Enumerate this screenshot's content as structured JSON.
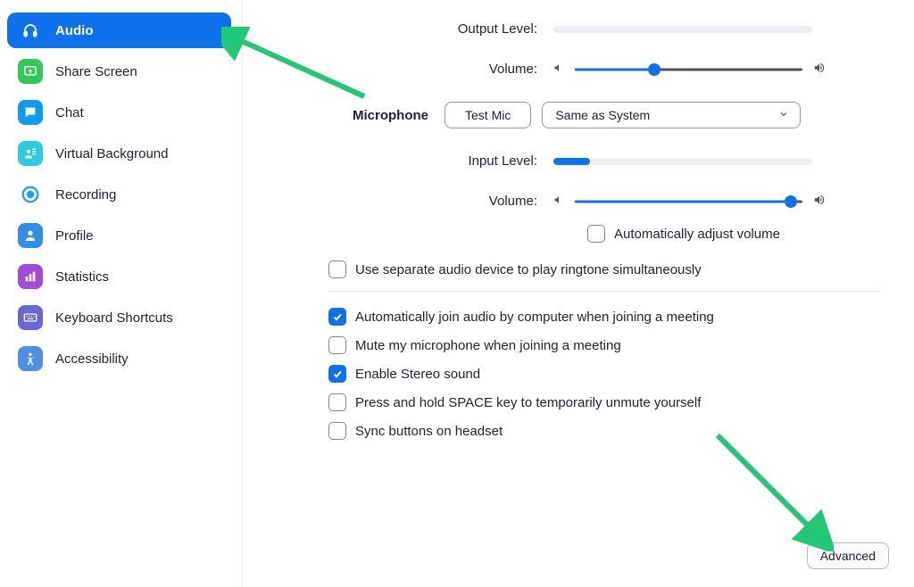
{
  "sidebar": {
    "items": [
      {
        "label": "Audio",
        "icon": "headphones-icon",
        "active": true,
        "iconBg": "#0e72ed",
        "iconFg": "#ffffff"
      },
      {
        "label": "Share Screen",
        "icon": "share-screen-icon",
        "active": false,
        "iconBg": "#34c759",
        "iconFg": "#ffffff"
      },
      {
        "label": "Chat",
        "icon": "chat-icon",
        "active": false,
        "iconBg": "#0e9cf0",
        "iconFg": "#ffffff"
      },
      {
        "label": "Virtual Background",
        "icon": "virtual-bg-icon",
        "active": false,
        "iconBg": "#2fc9e0",
        "iconFg": "#ffffff"
      },
      {
        "label": "Recording",
        "icon": "recording-icon",
        "active": false,
        "iconBg": "#ffffff",
        "iconFg": "#1aa0f0"
      },
      {
        "label": "Profile",
        "icon": "profile-icon",
        "active": false,
        "iconBg": "#2f8fe8",
        "iconFg": "#ffffff"
      },
      {
        "label": "Statistics",
        "icon": "statistics-icon",
        "active": false,
        "iconBg": "#a24dd8",
        "iconFg": "#ffffff"
      },
      {
        "label": "Keyboard Shortcuts",
        "icon": "keyboard-icon",
        "active": false,
        "iconBg": "#6b66d6",
        "iconFg": "#ffffff"
      },
      {
        "label": "Accessibility",
        "icon": "accessibility-icon",
        "active": false,
        "iconBg": "#4e8fe2",
        "iconFg": "#ffffff"
      }
    ]
  },
  "main": {
    "outputLevelLabel": "Output Level:",
    "volumeLabel": "Volume:",
    "microphoneLabel": "Microphone",
    "testMicBtn": "Test Mic",
    "micDeviceSelected": "Same as System",
    "inputLevelLabel": "Input Level:",
    "inputLevelPct": 14,
    "outputLevelPct": 0,
    "outputVolumePct": 35,
    "inputVolumePct": 95,
    "autoAdjust": {
      "label": "Automatically adjust volume",
      "checked": false
    },
    "options": [
      {
        "label": "Use separate audio device to play ringtone simultaneously",
        "checked": false
      },
      {
        "label": "Automatically join audio by computer when joining a meeting",
        "checked": true
      },
      {
        "label": "Mute my microphone when joining a meeting",
        "checked": false
      },
      {
        "label": "Enable Stereo sound",
        "checked": true
      },
      {
        "label": "Press and hold SPACE key to temporarily unmute yourself",
        "checked": false
      },
      {
        "label": "Sync buttons on headset",
        "checked": false
      }
    ],
    "advancedBtn": "Advanced"
  }
}
